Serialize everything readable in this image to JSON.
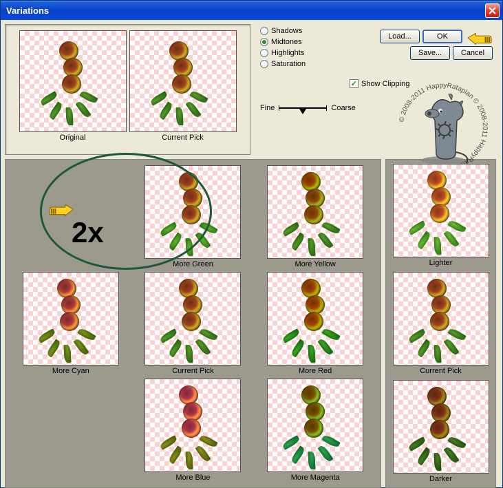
{
  "window": {
    "title": "Variations"
  },
  "buttons": {
    "load": "Load...",
    "ok": "OK",
    "save": "Save...",
    "cancel": "Cancel"
  },
  "radios": {
    "shadows": "Shadows",
    "midtones": "Midtones",
    "highlights": "Highlights",
    "saturation": "Saturation"
  },
  "slider": {
    "fine": "Fine",
    "coarse": "Coarse"
  },
  "checkbox": {
    "show_clipping": "Show Clipping"
  },
  "top_thumbs": {
    "original": "Original",
    "current": "Current Pick"
  },
  "grid": {
    "more_green": "More Green",
    "more_yellow": "More Yellow",
    "more_cyan": "More Cyan",
    "current_pick": "Current Pick",
    "more_red": "More Red",
    "more_blue": "More Blue",
    "more_magenta": "More Magenta"
  },
  "brightness": {
    "lighter": "Lighter",
    "current_pick": "Current Pick",
    "darker": "Darker"
  },
  "annotation": {
    "text": "2x"
  },
  "watermark": {
    "text_top": "2008-2011  HappyRataplan",
    "text_bottom": "© 2008-2011  HappyRataplan ©"
  }
}
